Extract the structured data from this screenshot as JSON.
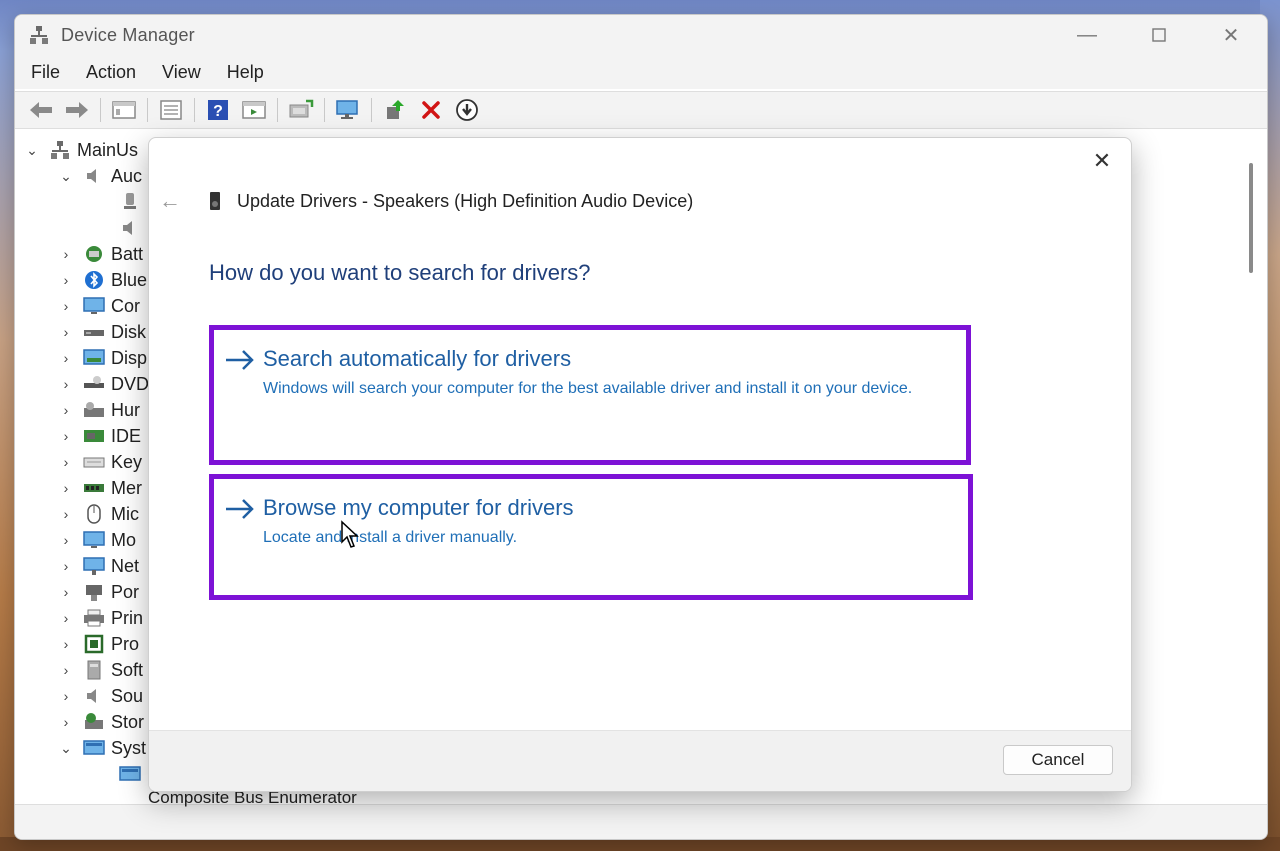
{
  "window": {
    "title": "Device Manager",
    "controls": [
      "minimize-icon",
      "maximize-icon",
      "close-icon"
    ]
  },
  "menu": [
    "File",
    "Action",
    "View",
    "Help"
  ],
  "toolbar": {
    "buttons": [
      "back-icon",
      "forward-icon",
      "properties-icon",
      "list-icon",
      "help-icon",
      "view-icon",
      "update-driver-icon",
      "scan-hardware-icon",
      "enable-device-icon",
      "uninstall-icon",
      "download-icon"
    ]
  },
  "tree": {
    "root": "MainUs",
    "items": [
      {
        "label": "Auc",
        "chev": "⌄",
        "icon": "speaker-icon"
      },
      {
        "label": "",
        "chev": "",
        "icon": "microphone-icon"
      },
      {
        "label": "",
        "chev": "",
        "icon": "speaker-icon"
      },
      {
        "label": "Batt",
        "chev": "›",
        "icon": "battery-icon"
      },
      {
        "label": "Blue",
        "chev": "›",
        "icon": "bluetooth-icon"
      },
      {
        "label": "Cor",
        "chev": "›",
        "icon": "monitor-icon"
      },
      {
        "label": "Disk",
        "chev": "›",
        "icon": "disk-icon"
      },
      {
        "label": "Disp",
        "chev": "›",
        "icon": "display-adapter-icon"
      },
      {
        "label": "DVD",
        "chev": "›",
        "icon": "dvd-icon"
      },
      {
        "label": "Hur",
        "chev": "›",
        "icon": "hid-icon"
      },
      {
        "label": "IDE",
        "chev": "›",
        "icon": "ide-icon"
      },
      {
        "label": "Key",
        "chev": "›",
        "icon": "keyboard-icon"
      },
      {
        "label": "Mer",
        "chev": "›",
        "icon": "memory-icon"
      },
      {
        "label": "Mic",
        "chev": "›",
        "icon": "mouse-icon"
      },
      {
        "label": "Mo",
        "chev": "›",
        "icon": "monitor-icon"
      },
      {
        "label": "Net",
        "chev": "›",
        "icon": "network-icon"
      },
      {
        "label": "Por",
        "chev": "›",
        "icon": "port-icon"
      },
      {
        "label": "Prin",
        "chev": "›",
        "icon": "printer-icon"
      },
      {
        "label": "Pro",
        "chev": "›",
        "icon": "processor-icon"
      },
      {
        "label": "Soft",
        "chev": "›",
        "icon": "software-icon"
      },
      {
        "label": "Sou",
        "chev": "›",
        "icon": "speaker-icon"
      },
      {
        "label": "Stor",
        "chev": "›",
        "icon": "storage-icon"
      },
      {
        "label": "Syst",
        "chev": "⌄",
        "icon": "system-icon"
      }
    ],
    "bottom_item": "Composite Bus Enumerator"
  },
  "dialog": {
    "title": "Update Drivers - Speakers (High Definition Audio Device)",
    "question": "How do you want to search for drivers?",
    "options": [
      {
        "title": "Search automatically for drivers",
        "description": "Windows will search your computer for the best available driver and install it on your device."
      },
      {
        "title": "Browse my computer for drivers",
        "description": "Locate and install a driver manually."
      }
    ],
    "cancel_label": "Cancel",
    "highlight_color": "#7d12d6"
  }
}
